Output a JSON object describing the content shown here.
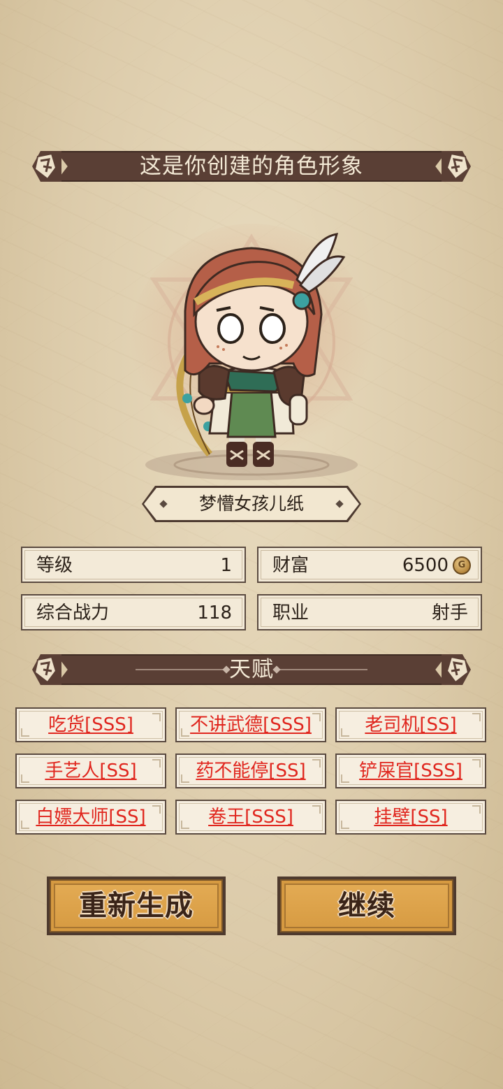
{
  "header": {
    "title": "这是你创建的角色形象"
  },
  "character": {
    "name": "梦懵女孩儿纸"
  },
  "stats": {
    "level_label": "等级",
    "level_value": "1",
    "wealth_label": "财富",
    "wealth_value": "6500",
    "power_label": "综合战力",
    "power_value": "118",
    "job_label": "职业",
    "job_value": "射手"
  },
  "talents": {
    "title": "天赋",
    "items": [
      "吃货[SSS]",
      "不讲武德[SSS]",
      "老司机[SS]",
      "手艺人[SS]",
      "药不能停[SS]",
      "铲屎官[SSS]",
      "白嫖大师[SS]",
      "卷王[SSS]",
      "挂壁[SS]"
    ]
  },
  "buttons": {
    "regenerate": "重新生成",
    "continue": "继续"
  },
  "colors": {
    "banner": "#5a3f35",
    "talent_text": "#e0261e",
    "button": "#d69a41"
  },
  "icons": {
    "coin": "coin-icon"
  }
}
